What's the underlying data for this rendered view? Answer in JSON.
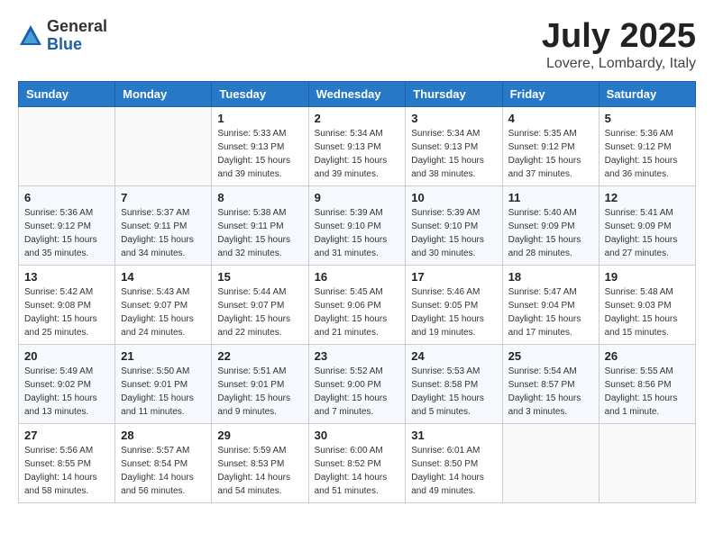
{
  "header": {
    "logo_general": "General",
    "logo_blue": "Blue",
    "month_title": "July 2025",
    "location": "Lovere, Lombardy, Italy"
  },
  "columns": [
    "Sunday",
    "Monday",
    "Tuesday",
    "Wednesday",
    "Thursday",
    "Friday",
    "Saturday"
  ],
  "weeks": [
    [
      {
        "day": "",
        "sunrise": "",
        "sunset": "",
        "daylight": ""
      },
      {
        "day": "",
        "sunrise": "",
        "sunset": "",
        "daylight": ""
      },
      {
        "day": "1",
        "sunrise": "Sunrise: 5:33 AM",
        "sunset": "Sunset: 9:13 PM",
        "daylight": "Daylight: 15 hours and 39 minutes."
      },
      {
        "day": "2",
        "sunrise": "Sunrise: 5:34 AM",
        "sunset": "Sunset: 9:13 PM",
        "daylight": "Daylight: 15 hours and 39 minutes."
      },
      {
        "day": "3",
        "sunrise": "Sunrise: 5:34 AM",
        "sunset": "Sunset: 9:13 PM",
        "daylight": "Daylight: 15 hours and 38 minutes."
      },
      {
        "day": "4",
        "sunrise": "Sunrise: 5:35 AM",
        "sunset": "Sunset: 9:12 PM",
        "daylight": "Daylight: 15 hours and 37 minutes."
      },
      {
        "day": "5",
        "sunrise": "Sunrise: 5:36 AM",
        "sunset": "Sunset: 9:12 PM",
        "daylight": "Daylight: 15 hours and 36 minutes."
      }
    ],
    [
      {
        "day": "6",
        "sunrise": "Sunrise: 5:36 AM",
        "sunset": "Sunset: 9:12 PM",
        "daylight": "Daylight: 15 hours and 35 minutes."
      },
      {
        "day": "7",
        "sunrise": "Sunrise: 5:37 AM",
        "sunset": "Sunset: 9:11 PM",
        "daylight": "Daylight: 15 hours and 34 minutes."
      },
      {
        "day": "8",
        "sunrise": "Sunrise: 5:38 AM",
        "sunset": "Sunset: 9:11 PM",
        "daylight": "Daylight: 15 hours and 32 minutes."
      },
      {
        "day": "9",
        "sunrise": "Sunrise: 5:39 AM",
        "sunset": "Sunset: 9:10 PM",
        "daylight": "Daylight: 15 hours and 31 minutes."
      },
      {
        "day": "10",
        "sunrise": "Sunrise: 5:39 AM",
        "sunset": "Sunset: 9:10 PM",
        "daylight": "Daylight: 15 hours and 30 minutes."
      },
      {
        "day": "11",
        "sunrise": "Sunrise: 5:40 AM",
        "sunset": "Sunset: 9:09 PM",
        "daylight": "Daylight: 15 hours and 28 minutes."
      },
      {
        "day": "12",
        "sunrise": "Sunrise: 5:41 AM",
        "sunset": "Sunset: 9:09 PM",
        "daylight": "Daylight: 15 hours and 27 minutes."
      }
    ],
    [
      {
        "day": "13",
        "sunrise": "Sunrise: 5:42 AM",
        "sunset": "Sunset: 9:08 PM",
        "daylight": "Daylight: 15 hours and 25 minutes."
      },
      {
        "day": "14",
        "sunrise": "Sunrise: 5:43 AM",
        "sunset": "Sunset: 9:07 PM",
        "daylight": "Daylight: 15 hours and 24 minutes."
      },
      {
        "day": "15",
        "sunrise": "Sunrise: 5:44 AM",
        "sunset": "Sunset: 9:07 PM",
        "daylight": "Daylight: 15 hours and 22 minutes."
      },
      {
        "day": "16",
        "sunrise": "Sunrise: 5:45 AM",
        "sunset": "Sunset: 9:06 PM",
        "daylight": "Daylight: 15 hours and 21 minutes."
      },
      {
        "day": "17",
        "sunrise": "Sunrise: 5:46 AM",
        "sunset": "Sunset: 9:05 PM",
        "daylight": "Daylight: 15 hours and 19 minutes."
      },
      {
        "day": "18",
        "sunrise": "Sunrise: 5:47 AM",
        "sunset": "Sunset: 9:04 PM",
        "daylight": "Daylight: 15 hours and 17 minutes."
      },
      {
        "day": "19",
        "sunrise": "Sunrise: 5:48 AM",
        "sunset": "Sunset: 9:03 PM",
        "daylight": "Daylight: 15 hours and 15 minutes."
      }
    ],
    [
      {
        "day": "20",
        "sunrise": "Sunrise: 5:49 AM",
        "sunset": "Sunset: 9:02 PM",
        "daylight": "Daylight: 15 hours and 13 minutes."
      },
      {
        "day": "21",
        "sunrise": "Sunrise: 5:50 AM",
        "sunset": "Sunset: 9:01 PM",
        "daylight": "Daylight: 15 hours and 11 minutes."
      },
      {
        "day": "22",
        "sunrise": "Sunrise: 5:51 AM",
        "sunset": "Sunset: 9:01 PM",
        "daylight": "Daylight: 15 hours and 9 minutes."
      },
      {
        "day": "23",
        "sunrise": "Sunrise: 5:52 AM",
        "sunset": "Sunset: 9:00 PM",
        "daylight": "Daylight: 15 hours and 7 minutes."
      },
      {
        "day": "24",
        "sunrise": "Sunrise: 5:53 AM",
        "sunset": "Sunset: 8:58 PM",
        "daylight": "Daylight: 15 hours and 5 minutes."
      },
      {
        "day": "25",
        "sunrise": "Sunrise: 5:54 AM",
        "sunset": "Sunset: 8:57 PM",
        "daylight": "Daylight: 15 hours and 3 minutes."
      },
      {
        "day": "26",
        "sunrise": "Sunrise: 5:55 AM",
        "sunset": "Sunset: 8:56 PM",
        "daylight": "Daylight: 15 hours and 1 minute."
      }
    ],
    [
      {
        "day": "27",
        "sunrise": "Sunrise: 5:56 AM",
        "sunset": "Sunset: 8:55 PM",
        "daylight": "Daylight: 14 hours and 58 minutes."
      },
      {
        "day": "28",
        "sunrise": "Sunrise: 5:57 AM",
        "sunset": "Sunset: 8:54 PM",
        "daylight": "Daylight: 14 hours and 56 minutes."
      },
      {
        "day": "29",
        "sunrise": "Sunrise: 5:59 AM",
        "sunset": "Sunset: 8:53 PM",
        "daylight": "Daylight: 14 hours and 54 minutes."
      },
      {
        "day": "30",
        "sunrise": "Sunrise: 6:00 AM",
        "sunset": "Sunset: 8:52 PM",
        "daylight": "Daylight: 14 hours and 51 minutes."
      },
      {
        "day": "31",
        "sunrise": "Sunrise: 6:01 AM",
        "sunset": "Sunset: 8:50 PM",
        "daylight": "Daylight: 14 hours and 49 minutes."
      },
      {
        "day": "",
        "sunrise": "",
        "sunset": "",
        "daylight": ""
      },
      {
        "day": "",
        "sunrise": "",
        "sunset": "",
        "daylight": ""
      }
    ]
  ]
}
